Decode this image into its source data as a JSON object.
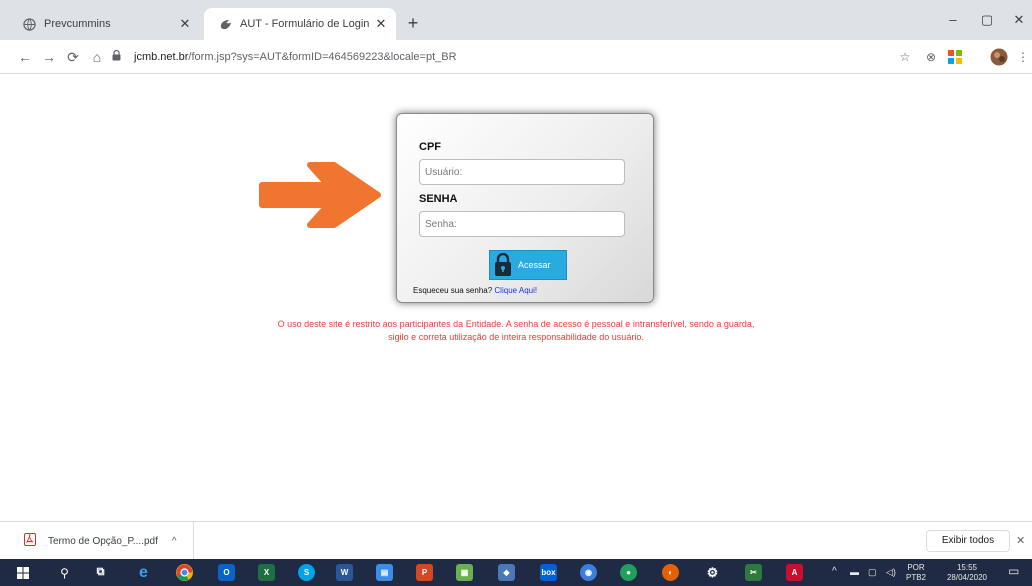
{
  "browser": {
    "tabs": [
      {
        "title": "Prevcummins",
        "active": false
      },
      {
        "title": "AUT - Formulário de Login - Prev",
        "active": true
      }
    ],
    "new_tab_symbol": "+",
    "url_host": "jcmb.net.br",
    "url_path": "/form.jsp?sys=AUT&formID=464569223&locale=pt_BR",
    "window_controls": {
      "minimize": "–",
      "restore": "▢",
      "close": "✕"
    }
  },
  "login": {
    "cpf_label": "CPF",
    "cpf_placeholder": "Usuário:",
    "senha_label": "SENHA",
    "senha_placeholder": "Senha:",
    "button_label": "Acessar",
    "forgot_text": "Esqueceu sua senha?",
    "forgot_link": "Clique Aqui!"
  },
  "notice": {
    "line1": "O uso deste site é restrito aos participantes da Entidade. A senha de acesso é pessoal e intransferível, sendo a guarda,",
    "line2": "sigilo e correta utilização de inteira responsabilidade do usuário."
  },
  "downloads": {
    "file_name": "Termo de Opção_P....pdf",
    "show_all": "Exibir todos",
    "close_symbol": "✕"
  },
  "taskbar": {
    "language": "POR",
    "keyboard": "PTB2",
    "time": "15:55",
    "date": "28/04/2020"
  },
  "colors": {
    "accent_arrow": "#f07530",
    "button_blue": "#29abe2",
    "notice_red": "#f03a3a",
    "link_blue": "#1a35d6"
  }
}
